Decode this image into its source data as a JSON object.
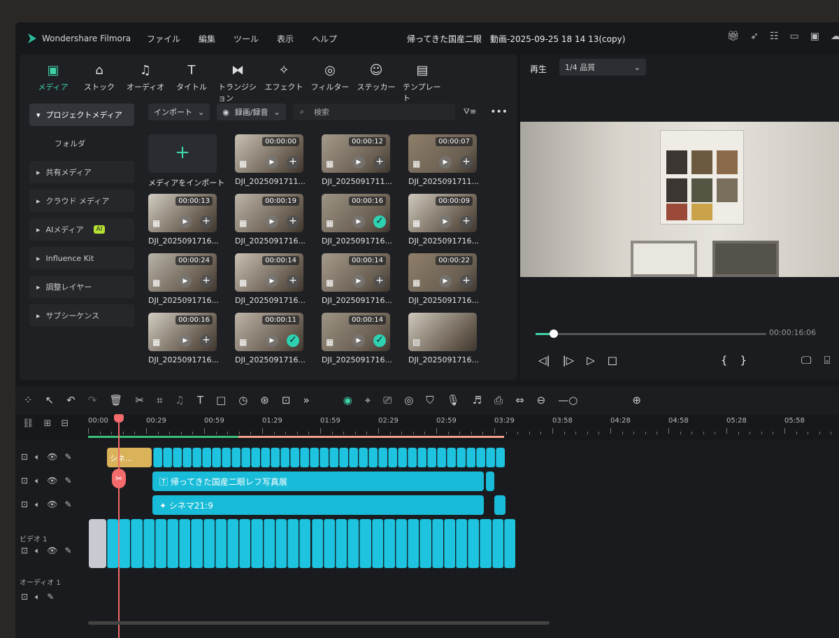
{
  "app": {
    "name": "Wondershare Filmora",
    "project_title": "帰ってきた国産二眼　動画-2025-09-25 18 14 13(copy)"
  },
  "menu": [
    "ファイル",
    "編集",
    "ツール",
    "表示",
    "ヘルプ"
  ],
  "top_icons": [
    "gift-icon",
    "send-icon",
    "task-icon",
    "layout-icon",
    "save-icon",
    "cloud-icon"
  ],
  "tools": [
    {
      "label": "メディア",
      "icon": "▣"
    },
    {
      "label": "ストック",
      "icon": "⌂"
    },
    {
      "label": "オーディオ",
      "icon": "♫"
    },
    {
      "label": "タイトル",
      "icon": "T"
    },
    {
      "label": "トランジション",
      "icon": "⧓"
    },
    {
      "label": "エフェクト",
      "icon": "✧"
    },
    {
      "label": "フィルター",
      "icon": "◎"
    },
    {
      "label": "ステッカー",
      "icon": "☺"
    },
    {
      "label": "テンプレート",
      "icon": "▤"
    }
  ],
  "sidebar": [
    {
      "label": "プロジェクトメディア",
      "selected": true
    },
    {
      "label": "フォルダ",
      "plain": true
    },
    {
      "label": "共有メディア"
    },
    {
      "label": "クラウド メディア"
    },
    {
      "label": "AIメディア",
      "badge": "AI"
    },
    {
      "label": "Influence Kit"
    },
    {
      "label": "調整レイヤー"
    },
    {
      "label": "サブシーケンス"
    }
  ],
  "media_toolbar": {
    "import": "インポート",
    "record": "録画/録音",
    "search_placeholder": "検索"
  },
  "media": [
    {
      "import": true,
      "label": "メディアをインポート"
    },
    {
      "duration": "00:00:00",
      "label": "DJI_2025091711..."
    },
    {
      "duration": "00:00:12",
      "label": "DJI_2025091711..."
    },
    {
      "duration": "00:00:07",
      "label": "DJI_2025091711..."
    },
    {
      "duration": "00:00:13",
      "label": "DJI_2025091716..."
    },
    {
      "duration": "00:00:19",
      "label": "DJI_2025091716..."
    },
    {
      "duration": "00:00:16",
      "label": "DJI_2025091716...",
      "added": true
    },
    {
      "duration": "00:00:09",
      "label": "DJI_2025091716..."
    },
    {
      "duration": "00:00:24",
      "label": "DJI_2025091716..."
    },
    {
      "duration": "00:00:14",
      "label": "DJI_2025091716..."
    },
    {
      "duration": "00:00:14",
      "label": "DJI_2025091716..."
    },
    {
      "duration": "00:00:22",
      "label": "DJI_2025091716..."
    },
    {
      "duration": "00:00:16",
      "label": "DJI_2025091716..."
    },
    {
      "duration": "00:00:11",
      "label": "DJI_2025091716...",
      "added": true
    },
    {
      "duration": "00:00:14",
      "label": "DJI_2025091716...",
      "added": true
    },
    {
      "label": "DJI_2025091716...",
      "image": true
    }
  ],
  "preview": {
    "playback_label": "再生",
    "quality": "1/4 品質",
    "timecode": "00:00:16:06",
    "progress": 0.08
  },
  "ruler": [
    "00:00",
    "00:29",
    "00:59",
    "01:29",
    "01:59",
    "02:29",
    "02:59",
    "03:29",
    "03:58",
    "04:28",
    "04:58",
    "05:28",
    "05:58"
  ],
  "tracks": {
    "title_clip": "シネ...",
    "text_clip": "帰ってきた国産二眼レフ写真展",
    "effect_clip": "シネマ21:9",
    "video_label": "ビデオ 1",
    "audio_label": "オーディオ 1"
  },
  "colors": {
    "accent": "#3fd2a9",
    "clip": "#1dc3df",
    "playhead": "#f36b6b",
    "title_clip": "#d9b25a"
  }
}
